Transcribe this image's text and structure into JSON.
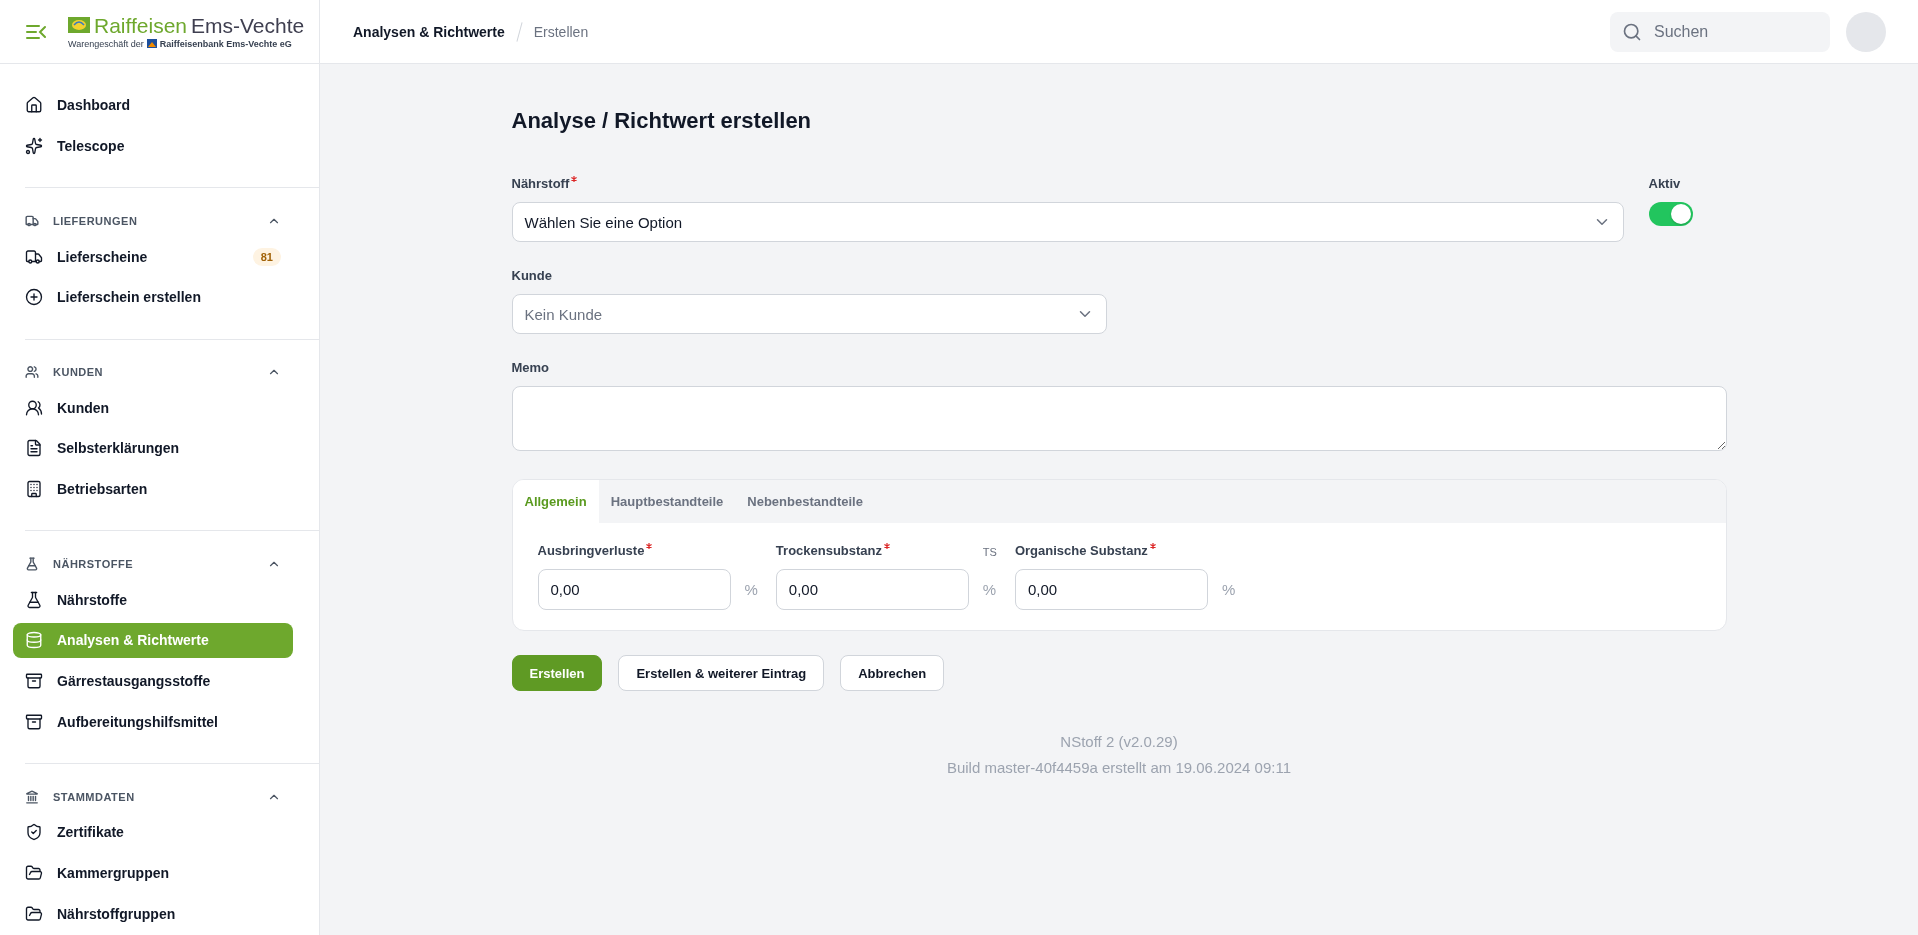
{
  "header": {
    "brand": {
      "name_first": "Raiffeisen",
      "name_second": "Ems-Vechte",
      "tagline_first": "Warengeschäft der",
      "tagline_second": "Raiffeisenbank Ems-Vechte eG"
    },
    "breadcrumbs": [
      "Analysen & Richtwerte",
      "Erstellen"
    ],
    "search": {
      "placeholder": "Suchen"
    }
  },
  "sidebar": {
    "items": [
      {
        "label": "Dashboard",
        "selected": false
      },
      {
        "label": "Telescope",
        "selected": false
      }
    ],
    "groups": [
      {
        "title": "LIEFERUNGEN",
        "expanded": true,
        "items": [
          {
            "label": "Lieferscheine",
            "badge": "81",
            "selected": false
          },
          {
            "label": "Lieferschein erstellen",
            "selected": false
          }
        ]
      },
      {
        "title": "KUNDEN",
        "expanded": true,
        "items": [
          {
            "label": "Kunden",
            "selected": false
          },
          {
            "label": "Selbsterklärungen",
            "selected": false
          },
          {
            "label": "Betriebsarten",
            "selected": false
          }
        ]
      },
      {
        "title": "NÄHRSTOFFE",
        "expanded": true,
        "items": [
          {
            "label": "Nährstoffe",
            "selected": false
          },
          {
            "label": "Analysen & Richtwerte",
            "selected": true
          },
          {
            "label": "Gärrestausgangsstoffe",
            "selected": false
          },
          {
            "label": "Aufbereitungshilfsmittel",
            "selected": false
          }
        ]
      },
      {
        "title": "STAMMDATEN",
        "expanded": true,
        "items": [
          {
            "label": "Zertifikate",
            "selected": false
          },
          {
            "label": "Kammergruppen",
            "selected": false
          },
          {
            "label": "Nährstoffgruppen",
            "selected": false
          }
        ]
      }
    ]
  },
  "page": {
    "title": "Analyse / Richtwert erstellen",
    "nutrient": {
      "label": "Nährstoff",
      "required": true,
      "value": "Wählen Sie eine Option"
    },
    "active": {
      "label": "Aktiv",
      "on": true
    },
    "customer": {
      "label": "Kunde",
      "required": false,
      "placeholder": "Kein Kunde"
    },
    "memo": {
      "label": "Memo"
    },
    "tabs": [
      {
        "label": "Allgemein",
        "selected": true
      },
      {
        "label": "Hauptbestandteile",
        "selected": false
      },
      {
        "label": "Nebenbestandteile",
        "selected": false
      }
    ],
    "fields": [
      {
        "label": "Ausbringverluste",
        "required": true,
        "value": "0,00",
        "unit": "%"
      },
      {
        "label": "Trockensubstanz",
        "required": true,
        "hint": "TS",
        "value": "0,00",
        "unit": "%"
      },
      {
        "label": "Organische Substanz",
        "required": true,
        "value": "0,00",
        "unit": "%"
      }
    ],
    "buttons": [
      {
        "label": "Erstellen",
        "kind": "primary"
      },
      {
        "label": "Erstellen & weiterer Eintrag",
        "kind": "secondary"
      },
      {
        "label": "Abbrechen",
        "kind": "secondary"
      }
    ]
  },
  "footer": {
    "version": "NStoff 2 (v2.0.29)",
    "build": "Build master-40f4459a erstellt am 19.06.2024 09:11"
  }
}
